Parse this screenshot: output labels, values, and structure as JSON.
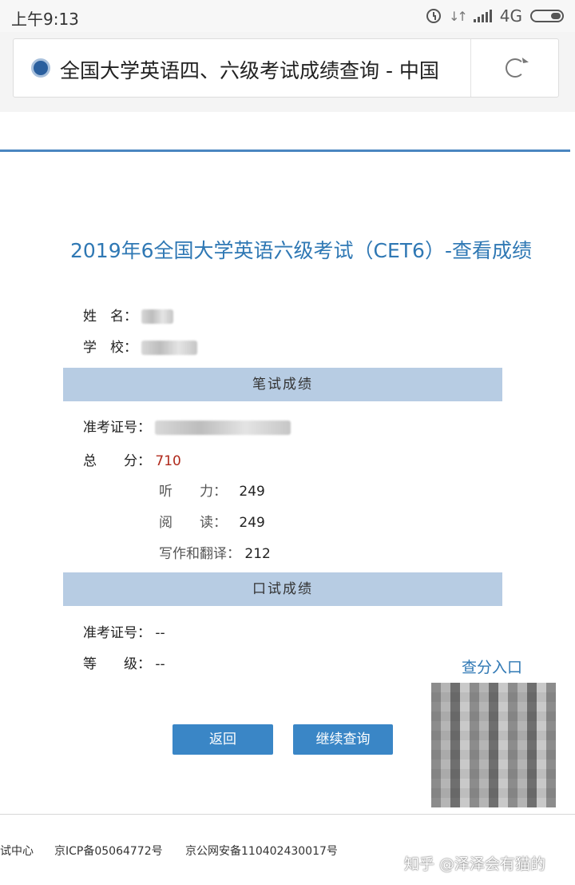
{
  "status_bar": {
    "time": "上午9:13",
    "network": "4G"
  },
  "browser": {
    "tab_title": "全国大学英语四、六级考试成绩查询 - 中国"
  },
  "page": {
    "title": "2019年6全国大学英语六级考试（CET6）-查看成绩",
    "name_label": "姓　名：",
    "school_label": "学　校：",
    "written_section": "笔试成绩",
    "ticket_label": "准考证号：",
    "total_label": "总　　分：",
    "total_score": "710",
    "listening_label": "听　　力：",
    "listening_score": "249",
    "reading_label": "阅　　读：",
    "reading_score": "249",
    "writing_label": "写作和翻译：",
    "writing_score": "212",
    "oral_section": "口试成绩",
    "oral_ticket_label": "准考证号：",
    "oral_ticket_value": "--",
    "grade_label": "等　　级：",
    "grade_value": "--",
    "back_button": "返回",
    "continue_button": "继续查询",
    "score_entry": "查分入口"
  },
  "footer": {
    "left": "试中心",
    "icp": "京ICP备05064772号",
    "police": "京公网安备110402430017号"
  },
  "watermark": "知乎 @泽泽会有猫的"
}
